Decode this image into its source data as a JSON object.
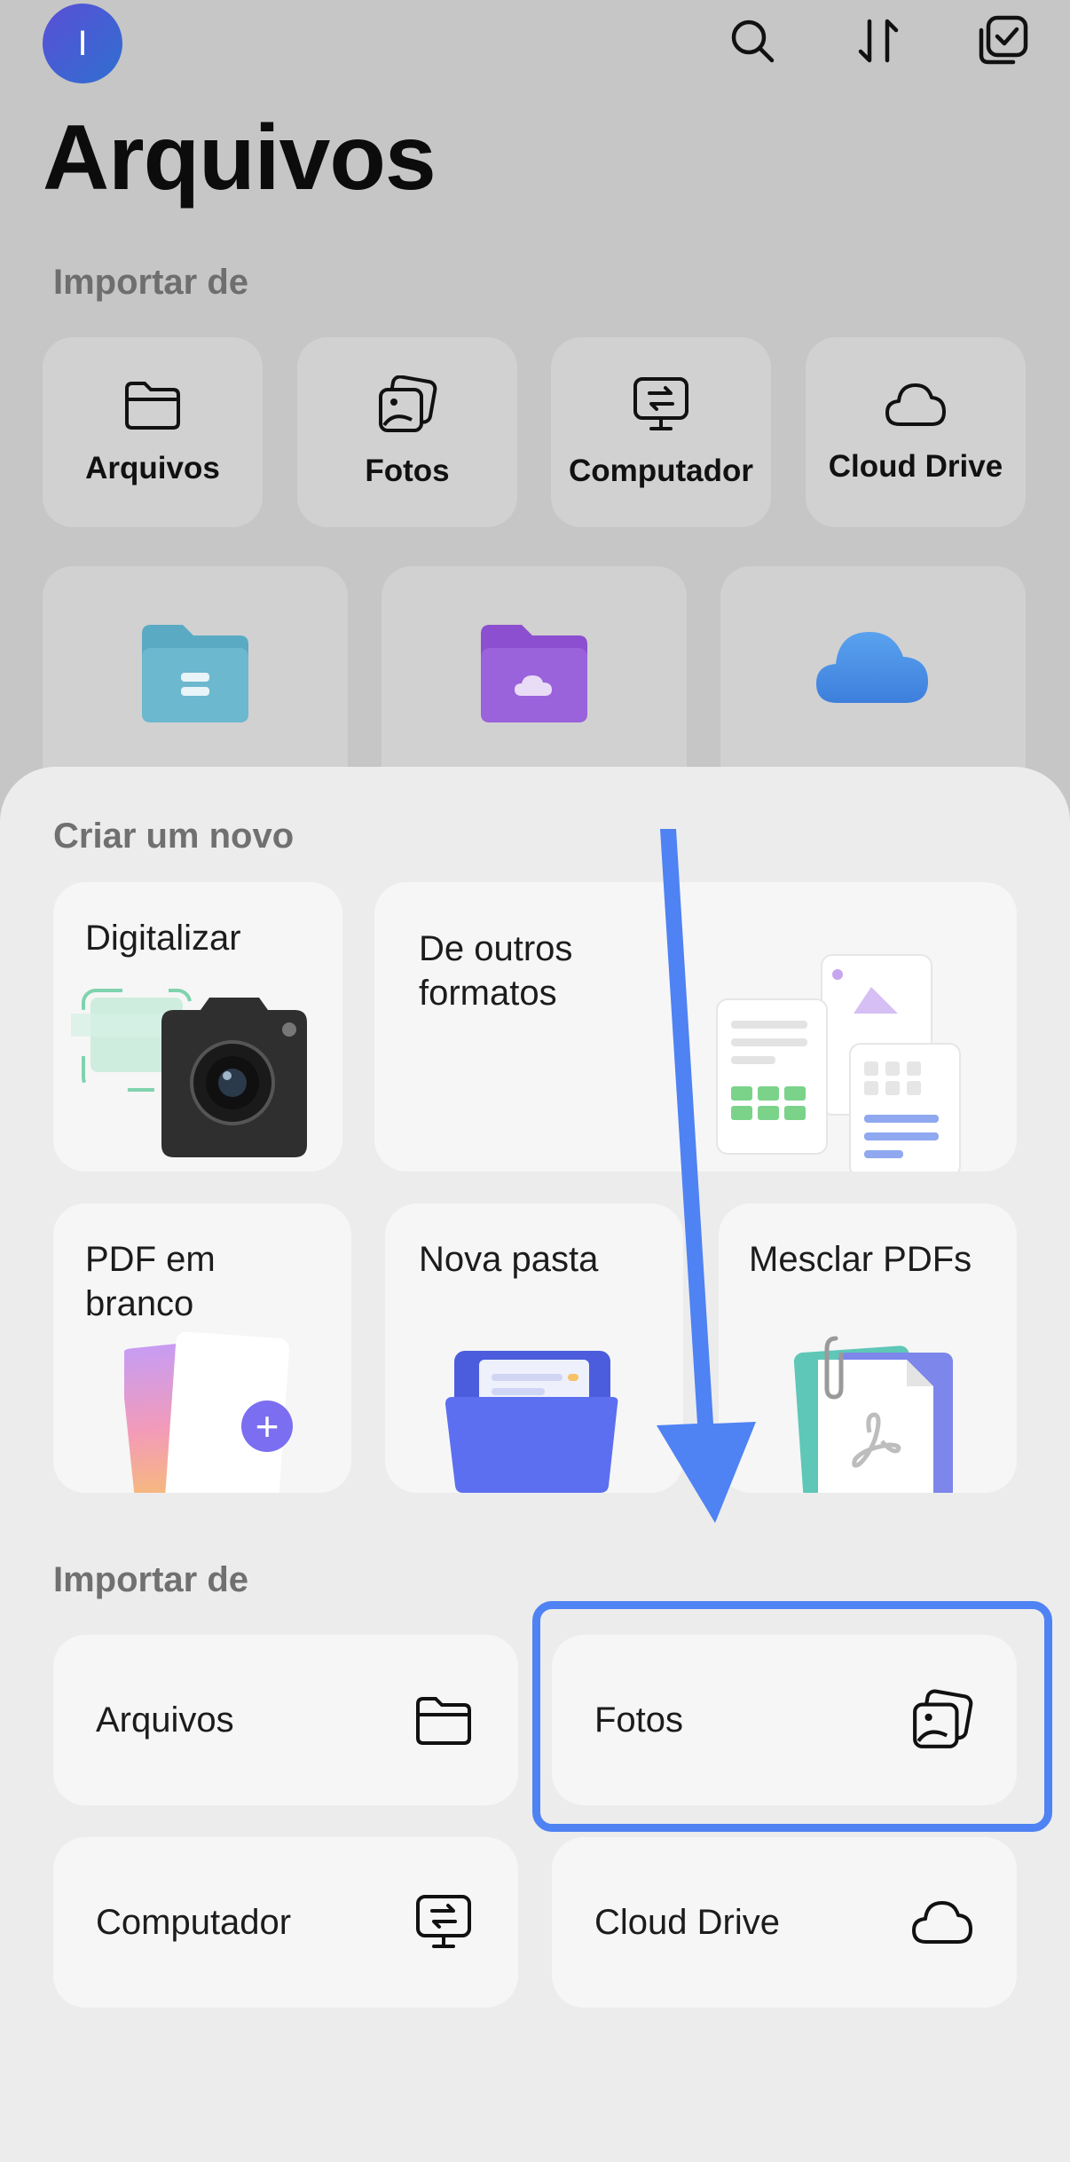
{
  "header": {
    "avatar_initial": "I",
    "title": "Arquivos",
    "icons": [
      "search-icon",
      "sort-icon",
      "select-icon"
    ]
  },
  "background": {
    "import_label": "Importar de",
    "sources": [
      {
        "label": "Arquivos",
        "icon": "folder-icon"
      },
      {
        "label": "Fotos",
        "icon": "photos-icon"
      },
      {
        "label": "Computador",
        "icon": "computer-icon"
      },
      {
        "label": "Cloud Drive",
        "icon": "cloud-icon"
      }
    ],
    "locations": [
      "files-app-icon",
      "cloud-folder-icon",
      "icloud-icon"
    ]
  },
  "sheet": {
    "create_label": "Criar um novo",
    "create": {
      "scan": "Digitalizar",
      "other_formats": "De outros\nformatos",
      "blank_pdf": "PDF em\nbranco",
      "new_folder": "Nova pasta",
      "merge_pdfs": "Mesclar PDFs"
    },
    "import_label": "Importar de",
    "import_items": [
      {
        "label": "Arquivos",
        "icon": "folder-icon"
      },
      {
        "label": "Fotos",
        "icon": "photos-icon"
      },
      {
        "label": "Computador",
        "icon": "computer-icon"
      },
      {
        "label": "Cloud Drive",
        "icon": "cloud-icon"
      }
    ]
  },
  "colors": {
    "accent_annotation": "#4f82f3",
    "background_dim": "#c6c6c6",
    "sheet": "#ececec"
  }
}
